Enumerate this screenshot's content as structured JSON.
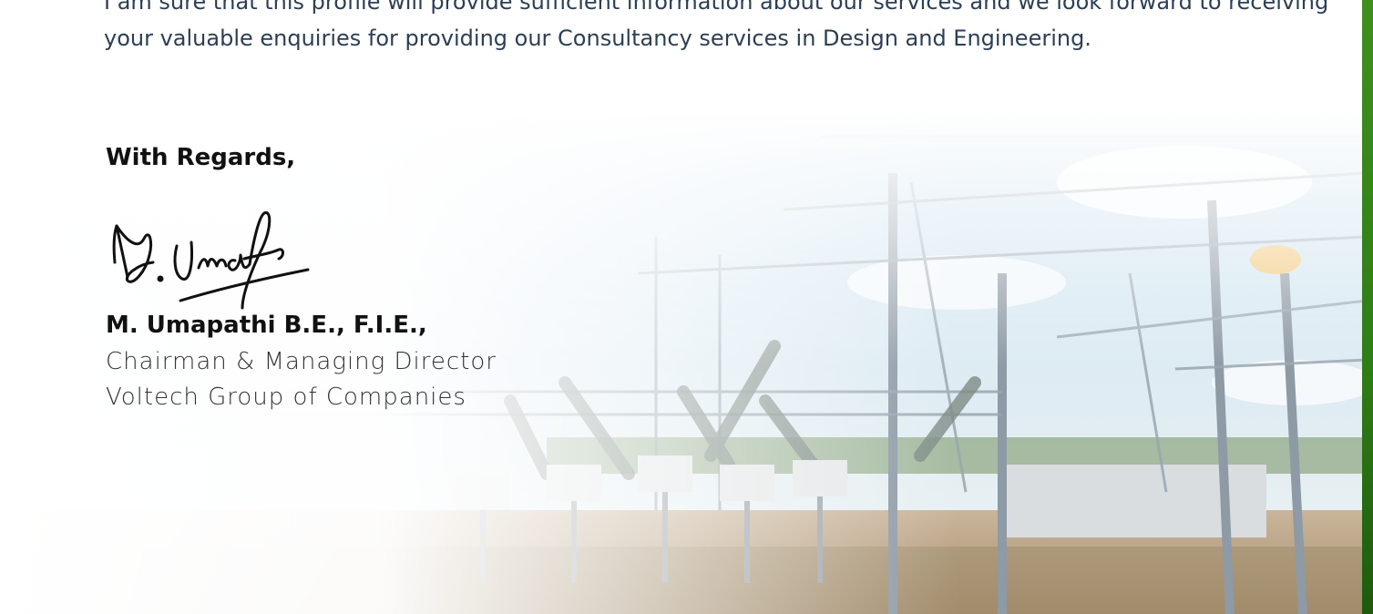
{
  "letter": {
    "intro_line1": "I am sure that this profile will provide sufficient information about our services and we look forward to receiving",
    "intro_line2": "your valuable enquiries for providing our Consultancy services in Design and Engineering.",
    "closing": "With Regards,",
    "signer_name": "M. Umapathi B.E., F.I.E.,",
    "signer_title": "Chairman & Managing Director",
    "signer_company": "Voltech Group of Companies"
  },
  "colors": {
    "accent_bar": "#2f7d16",
    "body_text": "#2b3f55"
  }
}
